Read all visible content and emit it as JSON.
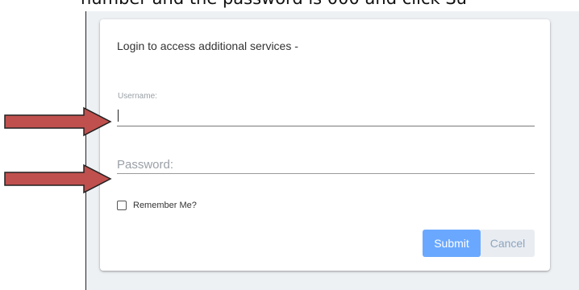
{
  "caption": {
    "text": "number and the password is 000 and click Su"
  },
  "login_card": {
    "title": "Login to access additional services -",
    "username": {
      "label": "Username:",
      "value": ""
    },
    "password": {
      "placeholder": "Password:",
      "value": ""
    },
    "remember_me": {
      "label": "Remember Me?",
      "checked": false
    },
    "buttons": {
      "submit_label": "Submit",
      "cancel_label": "Cancel"
    }
  },
  "annotations": {
    "arrow_color": "#c0504d",
    "arrow_outline": "#222222",
    "arrows": [
      "arrow-right-icon",
      "arrow-right-icon"
    ]
  },
  "colors": {
    "backdrop": "#eef1f4",
    "submit_bg": "#6aa8ff",
    "cancel_bg": "#e9edf2"
  }
}
